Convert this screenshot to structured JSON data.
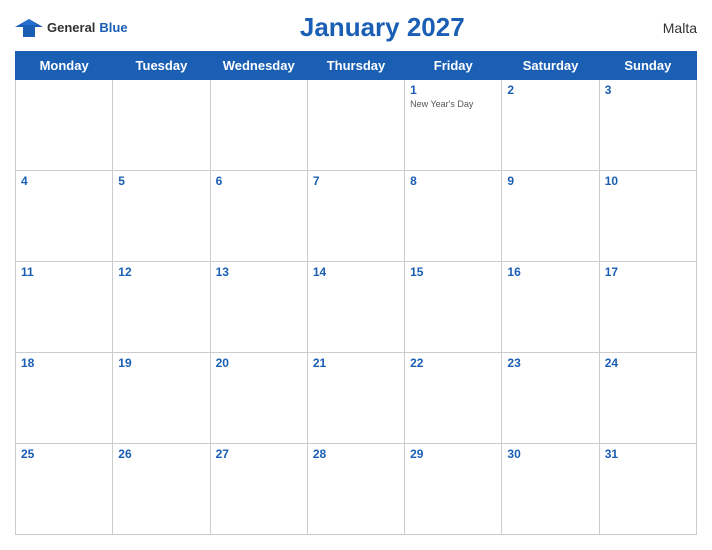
{
  "header": {
    "logo_general": "General",
    "logo_blue": "Blue",
    "title": "January 2027",
    "country": "Malta"
  },
  "days_of_week": [
    "Monday",
    "Tuesday",
    "Wednesday",
    "Thursday",
    "Friday",
    "Saturday",
    "Sunday"
  ],
  "weeks": [
    [
      {
        "date": "",
        "holiday": ""
      },
      {
        "date": "",
        "holiday": ""
      },
      {
        "date": "",
        "holiday": ""
      },
      {
        "date": "",
        "holiday": ""
      },
      {
        "date": "1",
        "holiday": "New Year's Day"
      },
      {
        "date": "2",
        "holiday": ""
      },
      {
        "date": "3",
        "holiday": ""
      }
    ],
    [
      {
        "date": "4",
        "holiday": ""
      },
      {
        "date": "5",
        "holiday": ""
      },
      {
        "date": "6",
        "holiday": ""
      },
      {
        "date": "7",
        "holiday": ""
      },
      {
        "date": "8",
        "holiday": ""
      },
      {
        "date": "9",
        "holiday": ""
      },
      {
        "date": "10",
        "holiday": ""
      }
    ],
    [
      {
        "date": "11",
        "holiday": ""
      },
      {
        "date": "12",
        "holiday": ""
      },
      {
        "date": "13",
        "holiday": ""
      },
      {
        "date": "14",
        "holiday": ""
      },
      {
        "date": "15",
        "holiday": ""
      },
      {
        "date": "16",
        "holiday": ""
      },
      {
        "date": "17",
        "holiday": ""
      }
    ],
    [
      {
        "date": "18",
        "holiday": ""
      },
      {
        "date": "19",
        "holiday": ""
      },
      {
        "date": "20",
        "holiday": ""
      },
      {
        "date": "21",
        "holiday": ""
      },
      {
        "date": "22",
        "holiday": ""
      },
      {
        "date": "23",
        "holiday": ""
      },
      {
        "date": "24",
        "holiday": ""
      }
    ],
    [
      {
        "date": "25",
        "holiday": ""
      },
      {
        "date": "26",
        "holiday": ""
      },
      {
        "date": "27",
        "holiday": ""
      },
      {
        "date": "28",
        "holiday": ""
      },
      {
        "date": "29",
        "holiday": ""
      },
      {
        "date": "30",
        "holiday": ""
      },
      {
        "date": "31",
        "holiday": ""
      }
    ]
  ]
}
